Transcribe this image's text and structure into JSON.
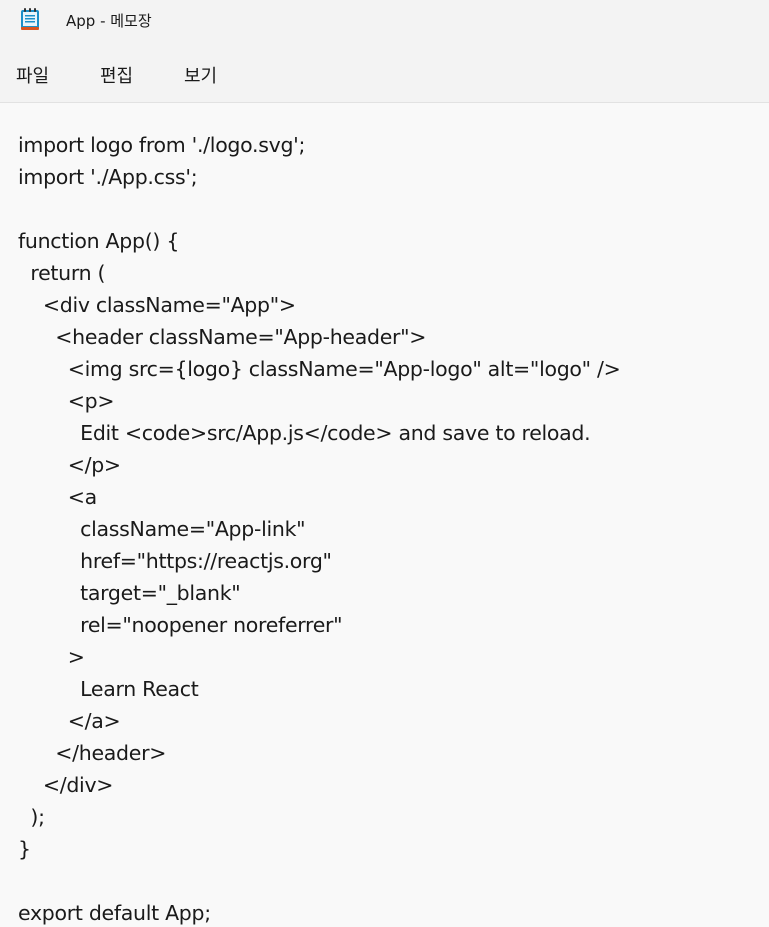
{
  "window": {
    "title": "App - 메모장",
    "icon": "notepad-icon"
  },
  "menu": {
    "items": [
      {
        "label": "파일"
      },
      {
        "label": "편집"
      },
      {
        "label": "보기"
      }
    ]
  },
  "editor": {
    "content": "import logo from './logo.svg';\nimport './App.css';\n\nfunction App() {\n  return (\n    <div className=\"App\">\n      <header className=\"App-header\">\n        <img src={logo} className=\"App-logo\" alt=\"logo\" />\n        <p>\n          Edit <code>src/App.js</code> and save to reload.\n        </p>\n        <a\n          className=\"App-link\"\n          href=\"https://reactjs.org\"\n          target=\"_blank\"\n          rel=\"noopener noreferrer\"\n        >\n          Learn React\n        </a>\n      </header>\n    </div>\n  );\n}\n\nexport default App;"
  },
  "colors": {
    "chrome_bg": "#f3f3f3",
    "editor_bg": "#f9f9f9",
    "text": "#1a1a1a",
    "icon_accent": "#1a8fc9"
  }
}
